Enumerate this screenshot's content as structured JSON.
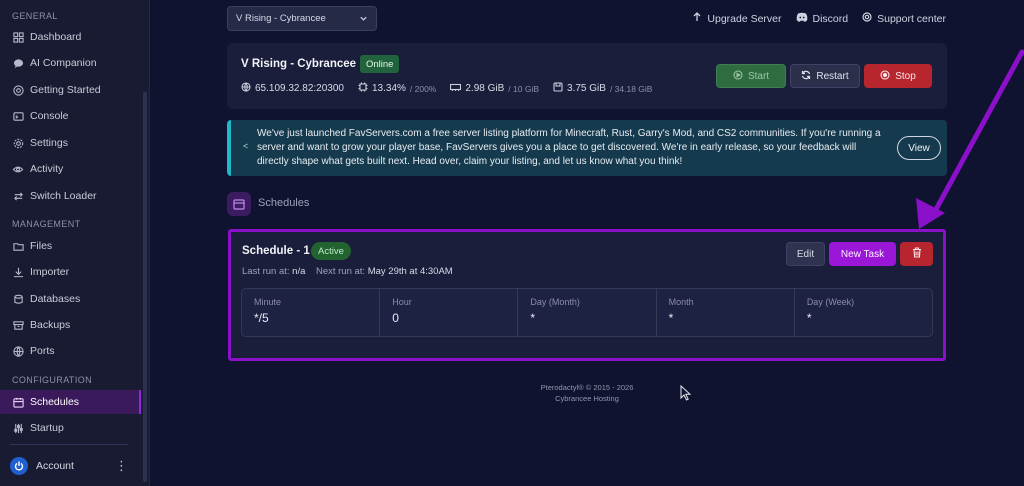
{
  "sidebar": {
    "sections": [
      {
        "label": "GENERAL"
      },
      {
        "label": "MANAGEMENT"
      },
      {
        "label": "CONFIGURATION"
      }
    ],
    "items": [
      {
        "label": "Dashboard",
        "icon": "grid-icon"
      },
      {
        "label": "AI Companion",
        "icon": "chat-icon"
      },
      {
        "label": "Getting Started",
        "icon": "compass-icon"
      },
      {
        "label": "Console",
        "icon": "terminal-icon"
      },
      {
        "label": "Settings",
        "icon": "gear-icon"
      },
      {
        "label": "Activity",
        "icon": "eye-icon"
      },
      {
        "label": "Switch Loader",
        "icon": "swap-icon"
      },
      {
        "label": "Files",
        "icon": "folder-icon"
      },
      {
        "label": "Importer",
        "icon": "download-icon"
      },
      {
        "label": "Databases",
        "icon": "database-icon"
      },
      {
        "label": "Backups",
        "icon": "archive-icon"
      },
      {
        "label": "Ports",
        "icon": "network-icon"
      },
      {
        "label": "Schedules",
        "icon": "calendar-icon"
      },
      {
        "label": "Startup",
        "icon": "sliders-icon"
      }
    ],
    "account_label": "Account"
  },
  "topbar": {
    "server_select": "V Rising - Cybrancee",
    "links": [
      {
        "label": "Upgrade Server",
        "icon": "arrow-up-icon"
      },
      {
        "label": "Discord",
        "icon": "discord-icon"
      },
      {
        "label": "Support center",
        "icon": "lifebuoy-icon"
      }
    ]
  },
  "server": {
    "name": "V Rising - Cybrancee",
    "status": "Online",
    "ip": "65.109.32.82:20300",
    "cpu": "13.34%",
    "cpu_limit": "/ 200%",
    "memory": "2.98 GiB",
    "memory_limit": "/ 10 GiB",
    "disk": "3.75 GiB",
    "disk_limit": "/ 34.18 GiB",
    "start_label": "Start",
    "restart_label": "Restart",
    "stop_label": "Stop"
  },
  "announcement": {
    "text": "We've just launched FavServers.com a free server listing platform for Minecraft, Rust, Garry's Mod, and CS2 communities. If you're running a server and want to grow your player base, FavServers gives you a place to get discovered. We're in early release, so your feedback will directly shape what gets built next. Head over, claim your listing, and let us know what you think!",
    "view_label": "View"
  },
  "schedules": {
    "heading": "Schedules",
    "items": [
      {
        "title": "Schedule - 1",
        "status": "Active",
        "last_run_label": "Last run at:",
        "last_run": "n/a",
        "next_run_label": "Next run at:",
        "next_run": "May 29th at 4:30AM",
        "edit_label": "Edit",
        "new_task_label": "New Task",
        "cron": [
          {
            "label": "Minute",
            "value": "*/5"
          },
          {
            "label": "Hour",
            "value": "0"
          },
          {
            "label": "Day (Month)",
            "value": "*"
          },
          {
            "label": "Month",
            "value": "*"
          },
          {
            "label": "Day (Week)",
            "value": "*"
          }
        ]
      }
    ]
  },
  "footer": {
    "line1": "Pterodactyl® © 2015 - 2026",
    "line2": "Cybrancee Hosting"
  },
  "colors": {
    "accent": "#9a17d8",
    "annotation": "#8b10c9",
    "online": "#20633c",
    "danger": "#b7262e"
  }
}
